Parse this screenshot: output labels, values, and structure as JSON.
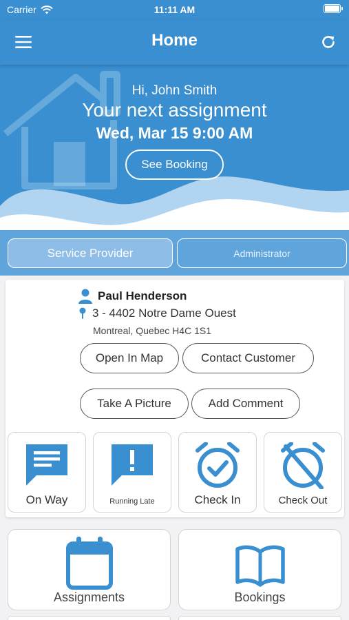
{
  "status_bar": {
    "carrier": "Carrier",
    "time": "11:11 AM"
  },
  "nav": {
    "title": "Home",
    "menu_icon": "menu-icon",
    "refresh_icon": "refresh-icon"
  },
  "hero": {
    "greeting": "Hi, John Smith",
    "headline": "Your next assignment",
    "datetime": "Wed, Mar 15 9:00 AM",
    "button_label": "See Booking"
  },
  "roles": {
    "active": "Service Provider",
    "inactive": "Administrator"
  },
  "booking": {
    "customer_name": "Paul Henderson",
    "address_line1": "3 -  4402 Notre Dame Ouest",
    "address_line2": "Montreal, Quebec H4C 1S1",
    "buttons": {
      "open_map": "Open In Map",
      "contact": "Contact Customer",
      "picture": "Take A Picture",
      "comment": "Add Comment"
    },
    "actions": [
      {
        "label": "On Way",
        "icon": "message-icon"
      },
      {
        "label": "Running Late",
        "icon": "alert-message-icon"
      },
      {
        "label": "Check In",
        "icon": "alarm-check-icon"
      },
      {
        "label": "Check Out",
        "icon": "alarm-off-icon"
      }
    ]
  },
  "tiles": [
    {
      "label": "Assignments",
      "icon": "calendar-icon"
    },
    {
      "label": "Bookings",
      "icon": "book-icon"
    }
  ],
  "colors": {
    "primary": "#3a8fd0",
    "role_bar": "#5fa5dc",
    "icon_blue": "#3a8fd0",
    "background": "#f2f2f4"
  }
}
